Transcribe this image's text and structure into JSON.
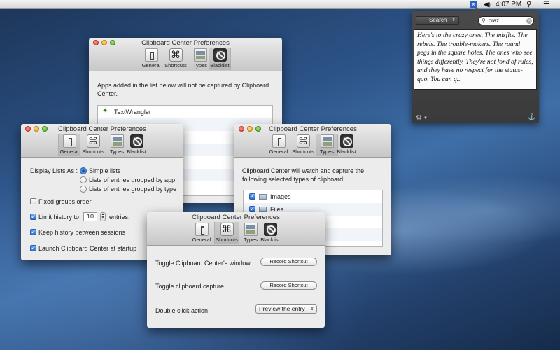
{
  "menubar": {
    "app_icon": "clipboard-center-icon",
    "volume_icon": "speaker-icon",
    "time": "4:07 PM",
    "search_icon": "magnifier-icon",
    "list_icon": "list-icon"
  },
  "popup": {
    "mode_label": "Search",
    "search_value": "craz",
    "clip_text": "Here's to the crazy ones. The misfits. The rebels. The trouble-makers. The round pegs in the square holes. The ones who see things differently. They're not fond of rules, and they have no respect for the status-quo. You can q..."
  },
  "toolbar": {
    "general": "General",
    "shortcuts": "Shortcuts",
    "types": "Types",
    "blacklist": "Blacklist"
  },
  "windows": {
    "title": "Clipboard Center Preferences"
  },
  "blacklist_pane": {
    "description": "Apps added in the list below will not be captured by Clipboard Center.",
    "apps": [
      "TextWrangler"
    ]
  },
  "general_pane": {
    "display_lists_label": "Display Lists As :",
    "display_options": [
      "Simple lists",
      "Lists of entries grouped by app",
      "Lists of entries grouped by type"
    ],
    "selected_display": "Simple lists",
    "fixed_groups_label": "Fixed groups order",
    "fixed_groups_checked": false,
    "limit_history_label": "Limit history to",
    "limit_history_checked": true,
    "limit_history_value": "10",
    "entries_label": "entries.",
    "keep_history_label": "Keep history between sessions",
    "keep_history_checked": true,
    "launch_label": "Launch Clipboard Center at startup",
    "launch_checked": true
  },
  "types_pane": {
    "description": "Clipboard Center will watch and capture the following selected types of clipboard.",
    "types": [
      {
        "label": "Images",
        "checked": true
      },
      {
        "label": "Files",
        "checked": true
      }
    ]
  },
  "shortcuts_pane": {
    "toggle_window_label": "Toggle Clipboard Center's window",
    "toggle_capture_label": "Toggle clipboard capture",
    "double_click_label": "Double click action",
    "record_shortcut_label": "Record Shortcut",
    "double_click_value": "Preview the entry"
  }
}
